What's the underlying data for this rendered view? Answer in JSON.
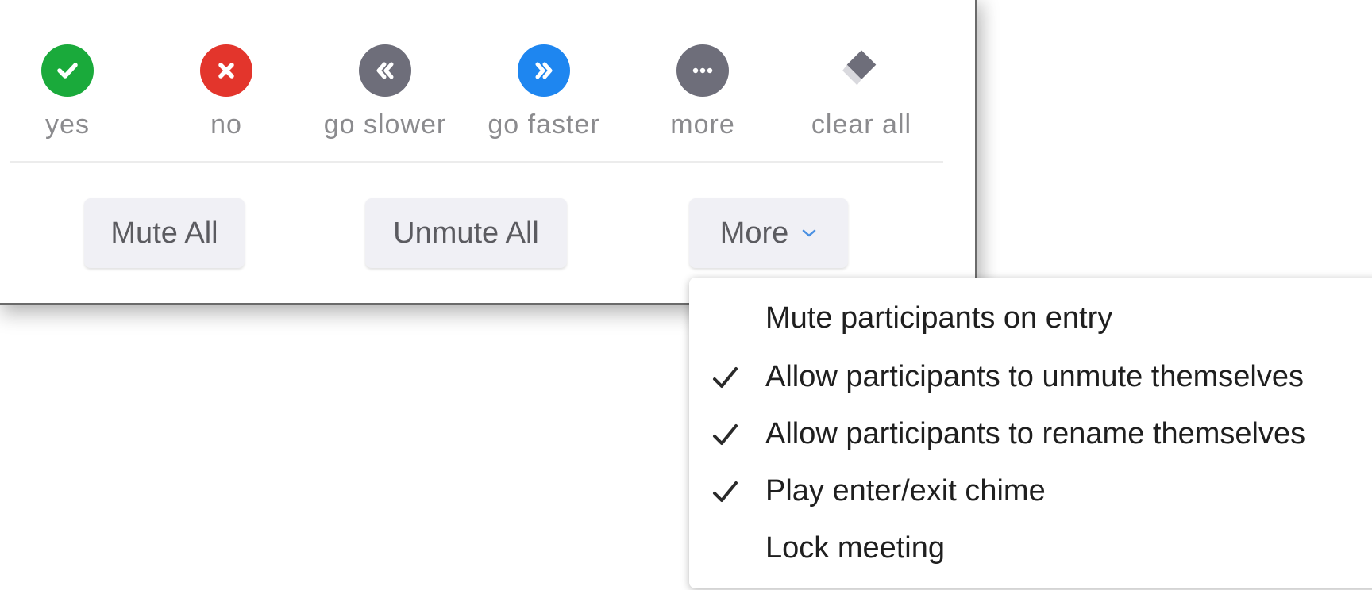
{
  "reactions": [
    {
      "label": "yes",
      "icon": "check-icon",
      "color": "#1aaa3b"
    },
    {
      "label": "no",
      "icon": "x-icon",
      "color": "#e3352c"
    },
    {
      "label": "go slower",
      "icon": "rewind-icon",
      "color": "#6e6e7a"
    },
    {
      "label": "go faster",
      "icon": "fast-forward-icon",
      "color": "#1e86f0"
    },
    {
      "label": "more",
      "icon": "ellipsis-icon",
      "color": "#6e6e7a"
    },
    {
      "label": "clear all",
      "icon": "eraser-icon",
      "color": "#6e6e7a"
    }
  ],
  "buttons": {
    "mute_all": "Mute All",
    "unmute_all": "Unmute All",
    "more": "More"
  },
  "menu": {
    "items": [
      {
        "label": "Mute participants on entry",
        "checked": false
      },
      {
        "label": "Allow participants to unmute themselves",
        "checked": true
      },
      {
        "label": "Allow participants to rename themselves",
        "checked": true
      },
      {
        "label": "Play enter/exit chime",
        "checked": true
      },
      {
        "label": "Lock meeting",
        "checked": false
      }
    ]
  },
  "colors": {
    "button_bg": "#f0f0f5",
    "label_gray": "#8b8b8e",
    "chevron_blue": "#4a90e2"
  }
}
